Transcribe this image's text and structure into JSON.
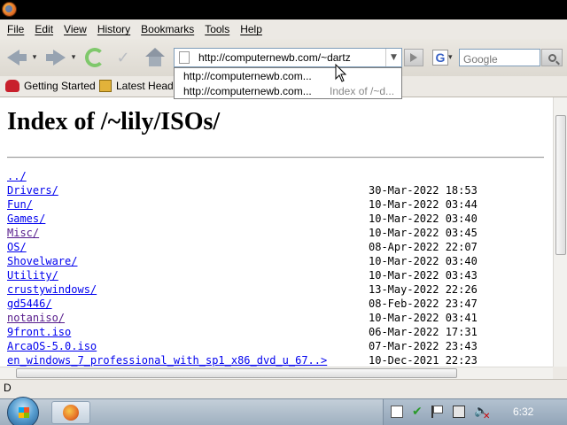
{
  "menu": [
    "File",
    "Edit",
    "View",
    "History",
    "Bookmarks",
    "Tools",
    "Help"
  ],
  "urlbar": {
    "value": "http://computernewb.com/~dartz"
  },
  "searchbar": {
    "placeholder": "Google",
    "engine_letter": "G"
  },
  "bookmarks": {
    "items": [
      "Getting Started",
      "Latest Headlines"
    ]
  },
  "autocomplete": [
    {
      "url": "http://computernewb.com...",
      "title": ""
    },
    {
      "url": "http://computernewb.com...",
      "title": "Index of /~d..."
    }
  ],
  "page": {
    "title": "Index of /~lily/ISOs/",
    "entries": [
      {
        "name": "../",
        "date": "",
        "visited": false
      },
      {
        "name": "Drivers/",
        "date": "30-Mar-2022 18:53",
        "visited": false
      },
      {
        "name": "Fun/",
        "date": "10-Mar-2022 03:44",
        "visited": false
      },
      {
        "name": "Games/",
        "date": "10-Mar-2022 03:40",
        "visited": false
      },
      {
        "name": "Misc/",
        "date": "10-Mar-2022 03:45",
        "visited": true
      },
      {
        "name": "OS/",
        "date": "08-Apr-2022 22:07",
        "visited": false
      },
      {
        "name": "Shovelware/",
        "date": "10-Mar-2022 03:40",
        "visited": false
      },
      {
        "name": "Utility/",
        "date": "10-Mar-2022 03:43",
        "visited": false
      },
      {
        "name": "crustywindows/",
        "date": "13-May-2022 22:26",
        "visited": false
      },
      {
        "name": "gd5446/",
        "date": "08-Feb-2022 23:47",
        "visited": false
      },
      {
        "name": "notaniso/",
        "date": "10-Mar-2022 03:41",
        "visited": true
      },
      {
        "name": "9front.iso",
        "date": "06-Mar-2022 17:31",
        "visited": false
      },
      {
        "name": "ArcaOS-5.0.iso",
        "date": "07-Mar-2022 23:43",
        "visited": false
      },
      {
        "name": "en_windows_7_professional_with_sp1_x86_dvd_u_67..>",
        "date": "10-Dec-2021 22:23",
        "visited": false
      }
    ]
  },
  "statusbar": {
    "text": "D"
  },
  "taskbar": {
    "clock": "6:32"
  }
}
